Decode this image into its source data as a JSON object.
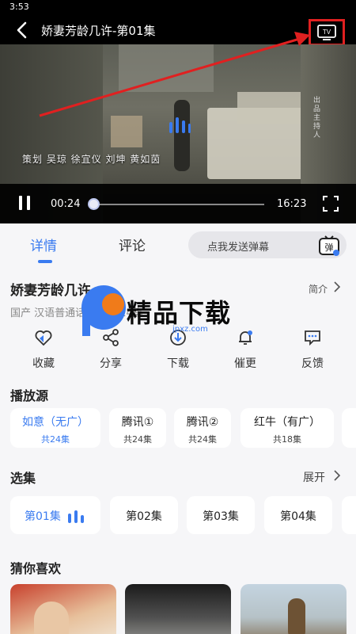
{
  "status": {
    "time": "3:53"
  },
  "header": {
    "title": "娇妻芳龄几许-第01集",
    "tv_label": "TV"
  },
  "video": {
    "credits": "策划 吴琼 徐宜仪 刘坤 黄如茵",
    "side_credit": "出品主持人",
    "current_time": "00:24",
    "total_time": "16:23",
    "progress_fraction": 0.015
  },
  "tabs": [
    {
      "label": "详情"
    },
    {
      "label": "评论"
    }
  ],
  "danmu": {
    "placeholder": "点我发送弹幕",
    "icon_label": "弹"
  },
  "show": {
    "title": "娇妻芳龄几许",
    "intro_label": "简介",
    "meta": "国产 汉语普通话 更新至24集"
  },
  "actions": [
    {
      "label": "收藏",
      "icon": "heart-icon"
    },
    {
      "label": "分享",
      "icon": "share-icon"
    },
    {
      "label": "下载",
      "icon": "download-icon"
    },
    {
      "label": "催更",
      "icon": "bell-icon"
    },
    {
      "label": "反馈",
      "icon": "feedback-icon"
    }
  ],
  "sources_section": {
    "title": "播放源"
  },
  "sources": [
    {
      "name": "如意（无广）",
      "count": "共24集"
    },
    {
      "name": "腾讯①",
      "count": "共24集"
    },
    {
      "name": "腾讯②",
      "count": "共24集"
    },
    {
      "name": "红牛（有广）",
      "count": "共18集"
    }
  ],
  "episodes_section": {
    "title": "选集",
    "expand_label": "展开"
  },
  "episodes": [
    {
      "label": "第01集"
    },
    {
      "label": "第02集"
    },
    {
      "label": "第03集"
    },
    {
      "label": "第04集"
    }
  ],
  "recommend_section": {
    "title": "猜你喜欢"
  },
  "watermark": {
    "text": "精品下载",
    "url": "jpxz.com"
  },
  "colors": {
    "accent": "#3a7bf0",
    "annotation": "#e02020"
  }
}
